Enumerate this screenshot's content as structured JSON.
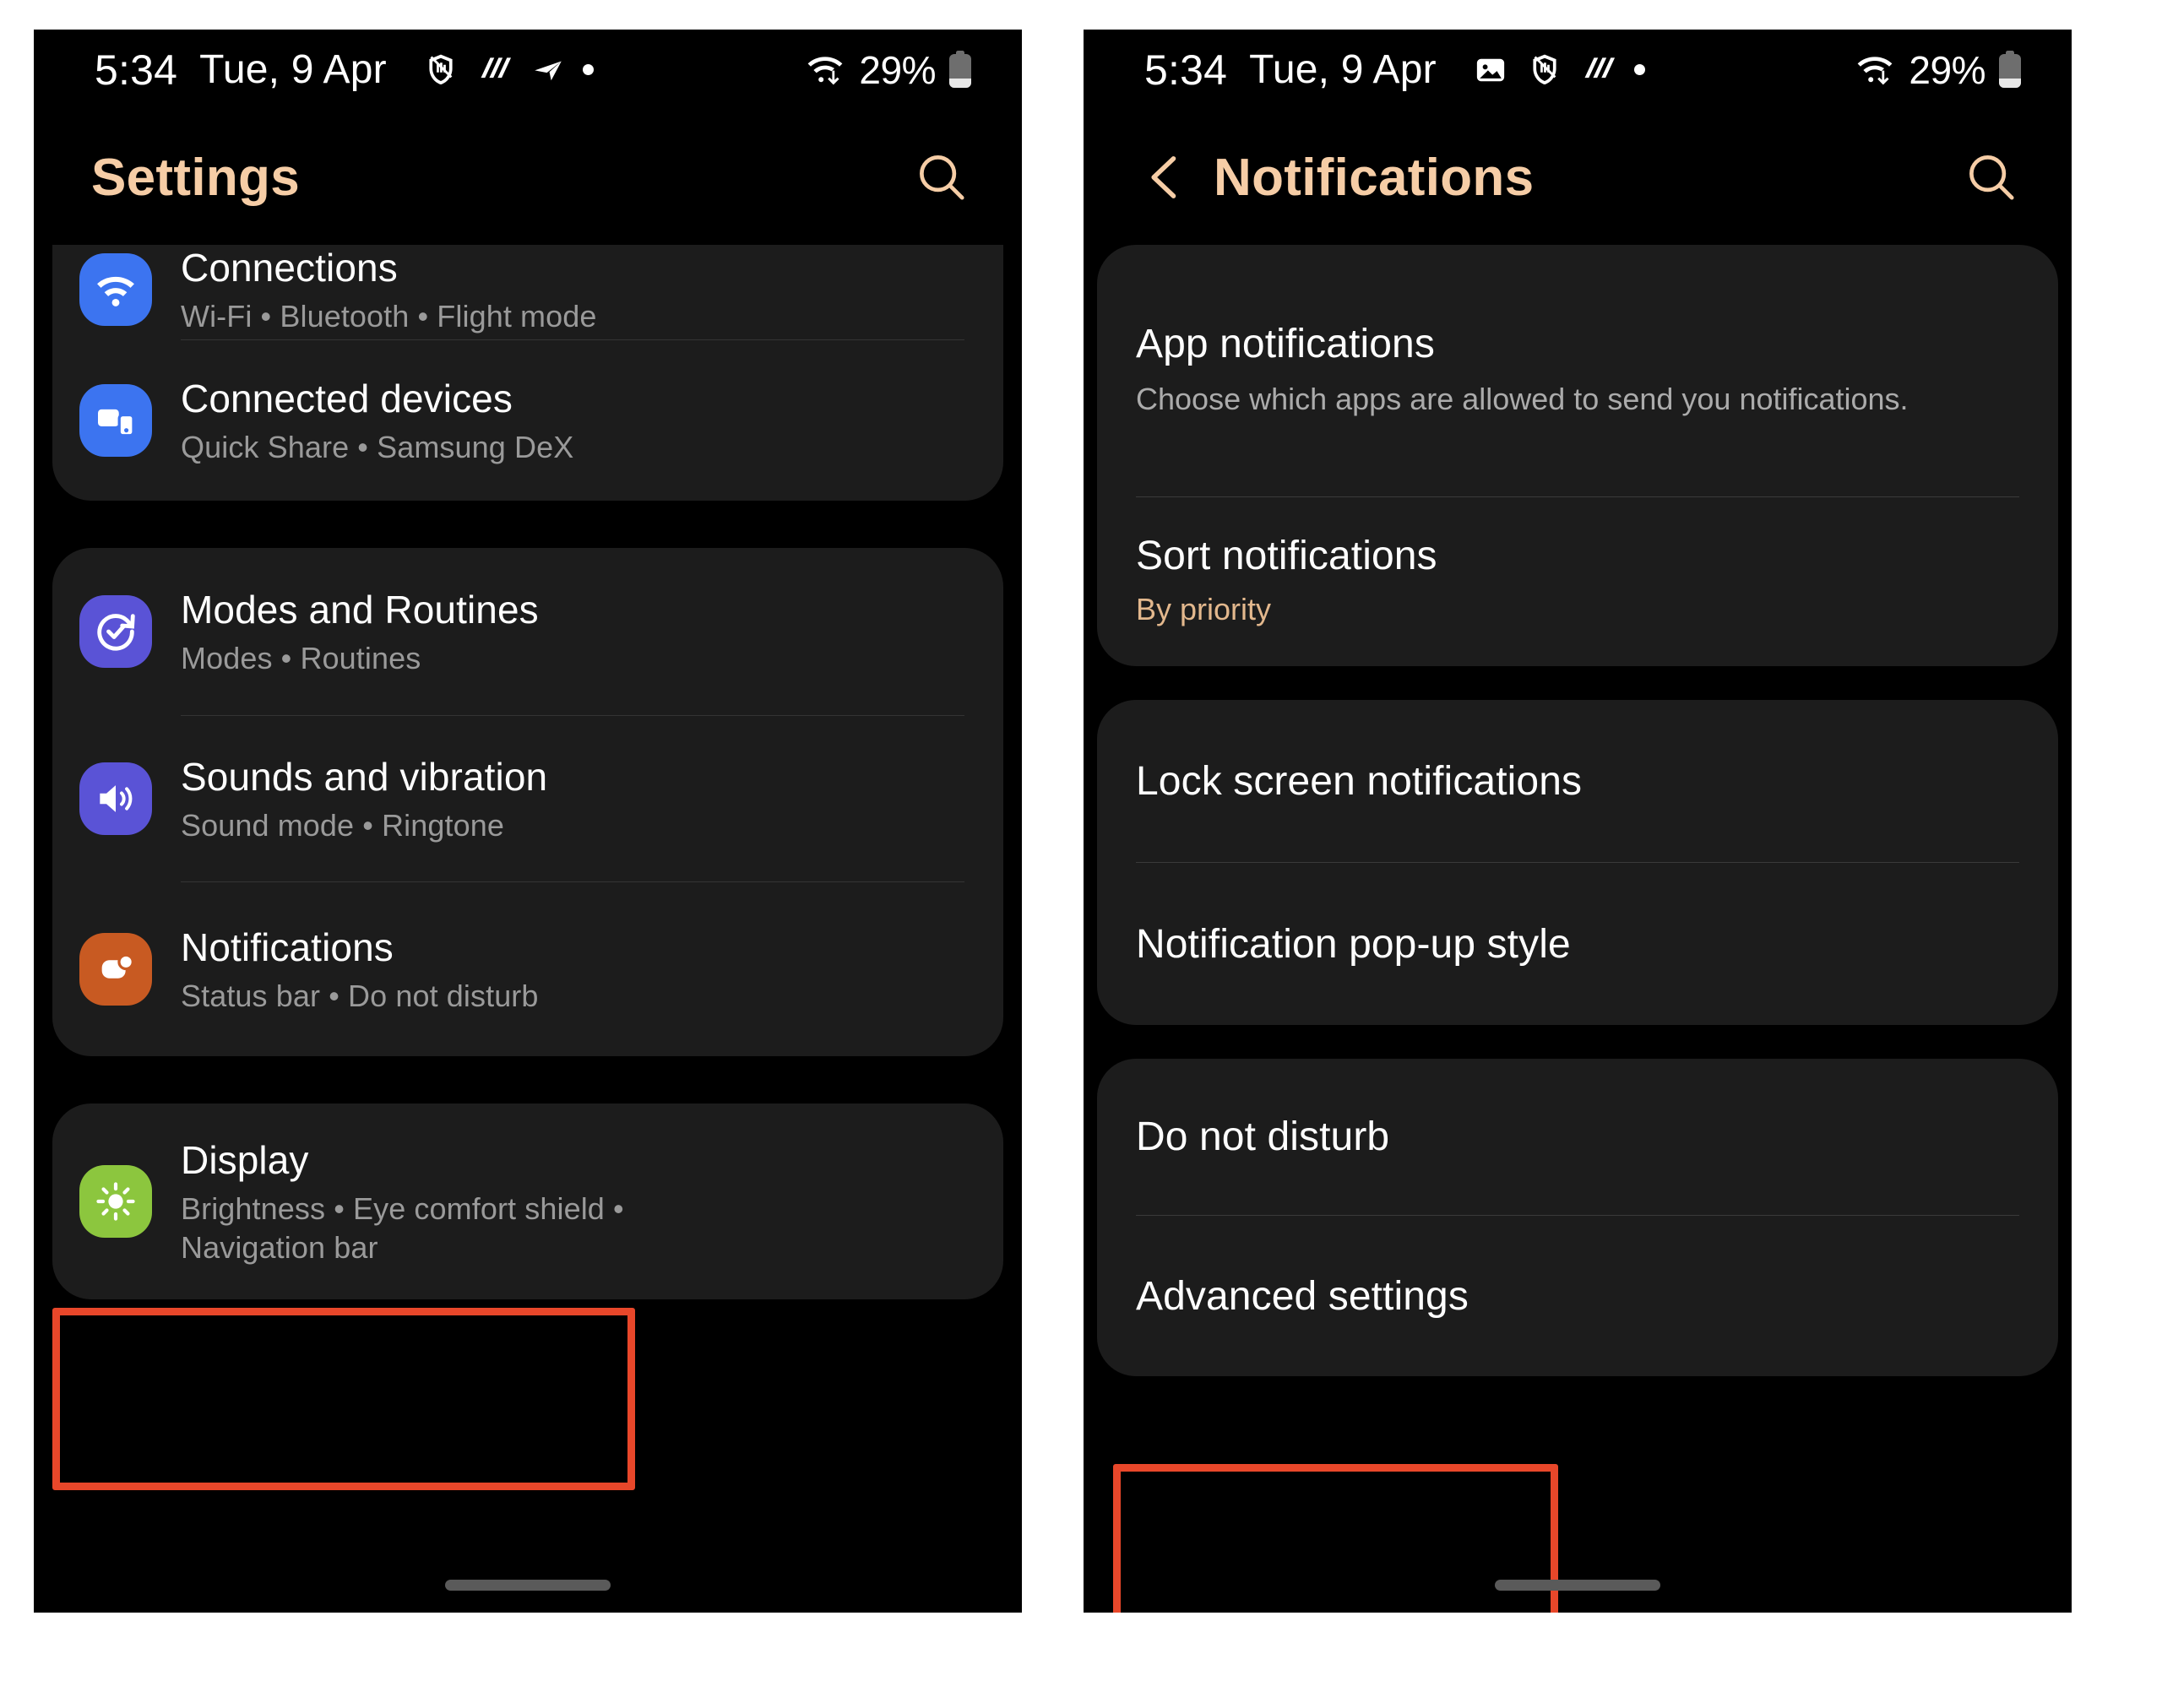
{
  "highlight_color": "#E8472A",
  "accent_color": "#F6CDA6",
  "phones": [
    {
      "id": "settings-screen",
      "status_bar": {
        "time": "5:34",
        "date": "Tue, 9 Apr",
        "icons": [
          "shield-hand-icon",
          "diagonal-lines-icon",
          "location-arrow-icon",
          "dot-icon"
        ],
        "wifi": "wifi-transfer-icon",
        "battery_text": "29%",
        "battery_icon": "battery-low-icon"
      },
      "header": {
        "title": "Settings",
        "search_icon": "search-icon"
      },
      "groups": [
        {
          "rows": [
            {
              "title": "Connections",
              "subtitle": "Wi-Fi  •  Bluetooth  •  Flight mode",
              "icon": "wifi-icon",
              "icon_color": "#3C74F0"
            },
            {
              "title": "Connected devices",
              "subtitle": "Quick Share  •  Samsung DeX",
              "icon": "connected-devices-icon",
              "icon_color": "#3C74F0"
            }
          ]
        },
        {
          "rows": [
            {
              "title": "Modes and Routines",
              "subtitle": "Modes  •  Routines",
              "icon": "modes-routines-icon",
              "icon_color": "#5A53D6"
            },
            {
              "title": "Sounds and vibration",
              "subtitle": "Sound mode  •  Ringtone",
              "icon": "volume-icon",
              "icon_color": "#5A53D6"
            },
            {
              "title": "Notifications",
              "subtitle": "Status bar  •  Do not disturb",
              "icon": "notifications-icon",
              "icon_color": "#C85A22",
              "highlighted": true
            }
          ]
        },
        {
          "rows": [
            {
              "title": "Display",
              "subtitle": "Brightness  •  Eye comfort shield  •",
              "subtitle2": "Navigation bar",
              "icon": "brightness-icon",
              "icon_color": "#8CC63E"
            }
          ]
        }
      ]
    },
    {
      "id": "notifications-screen",
      "status_bar": {
        "time": "5:34",
        "date": "Tue, 9 Apr",
        "icons": [
          "screenshot-icon",
          "shield-hand-icon",
          "diagonal-lines-icon",
          "dot-icon"
        ],
        "wifi": "wifi-transfer-icon",
        "battery_text": "29%",
        "battery_icon": "battery-low-icon"
      },
      "header": {
        "back_icon": "chevron-left-icon",
        "title": "Notifications",
        "search_icon": "search-icon"
      },
      "groups": [
        {
          "rows": [
            {
              "title": "App notifications",
              "subtitle": "Choose which apps are allowed to send you notifications."
            },
            {
              "title": "Sort notifications",
              "subtitle": "By priority",
              "subtitle_accent": true
            }
          ]
        },
        {
          "rows": [
            {
              "title": "Lock screen notifications"
            },
            {
              "title": "Notification pop-up style"
            }
          ]
        },
        {
          "rows": [
            {
              "title": "Do not disturb"
            },
            {
              "title": "Advanced settings",
              "highlighted": true
            }
          ]
        }
      ]
    }
  ]
}
